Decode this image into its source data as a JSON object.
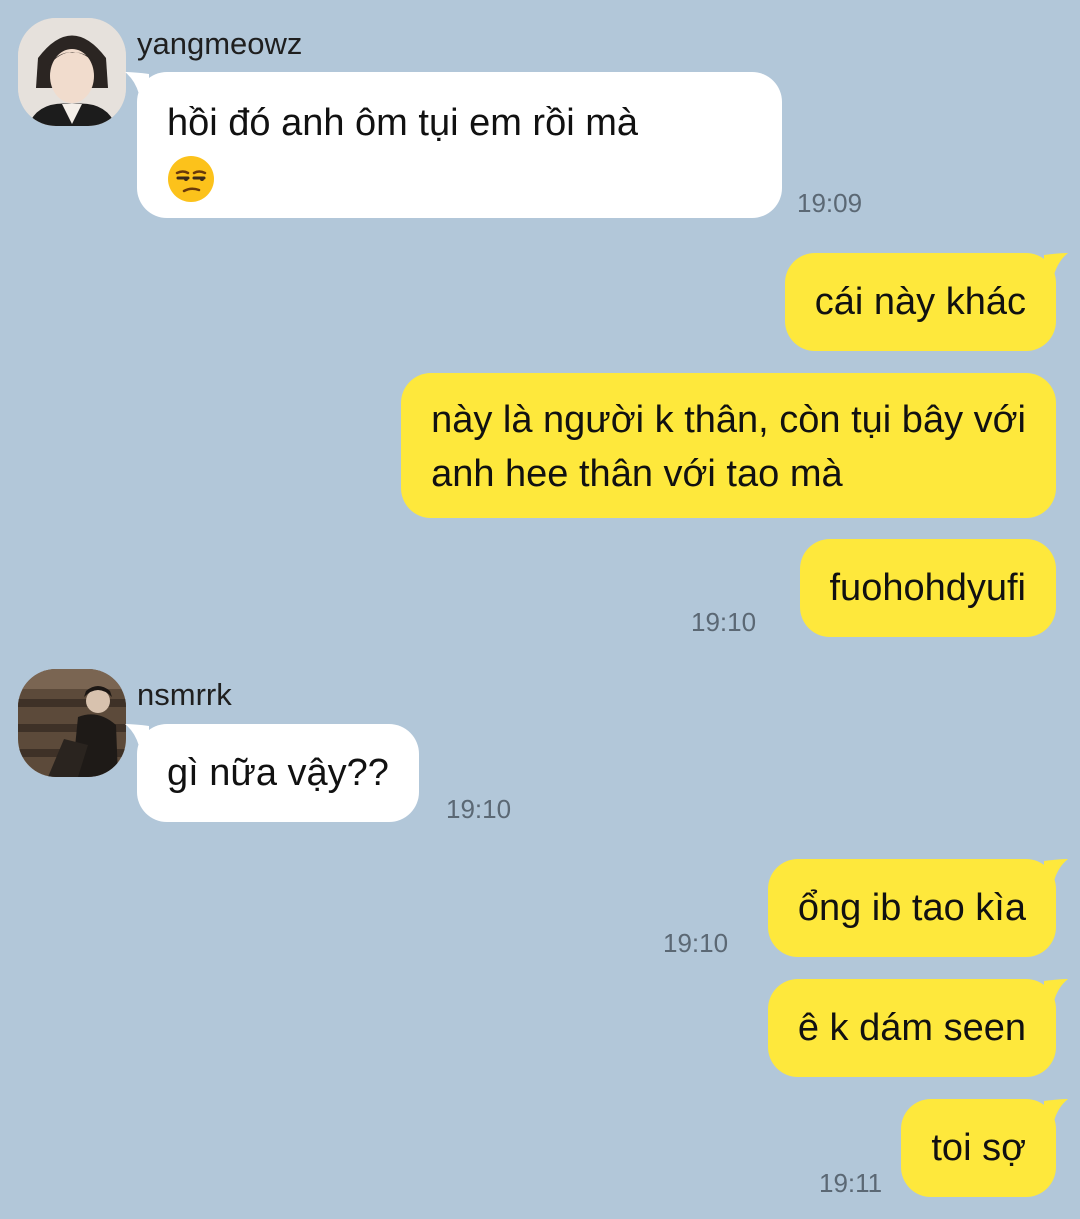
{
  "messages": [
    {
      "sender": "yangmeowz",
      "text": "hồi đó anh ôm tụi em rồi mà",
      "emoji": "unamused-face",
      "time": "19:09"
    },
    {
      "text": "cái này khác"
    },
    {
      "text_line1": "này là người k thân, còn tụi bây với",
      "text_line2": "anh hee thân với tao mà"
    },
    {
      "text": "fuohohdyufi",
      "time": "19:10"
    },
    {
      "sender": "nsmrrk",
      "text": "gì nữa vậy??",
      "time": "19:10"
    },
    {
      "text": "ổng ib tao kìa",
      "time": "19:10"
    },
    {
      "text": "ê k dám seen"
    },
    {
      "text": "toi sợ",
      "time": "19:11"
    }
  ],
  "colors": {
    "background": "#b2c7d9",
    "incoming": "#ffffff",
    "outgoing": "#fee83c"
  }
}
